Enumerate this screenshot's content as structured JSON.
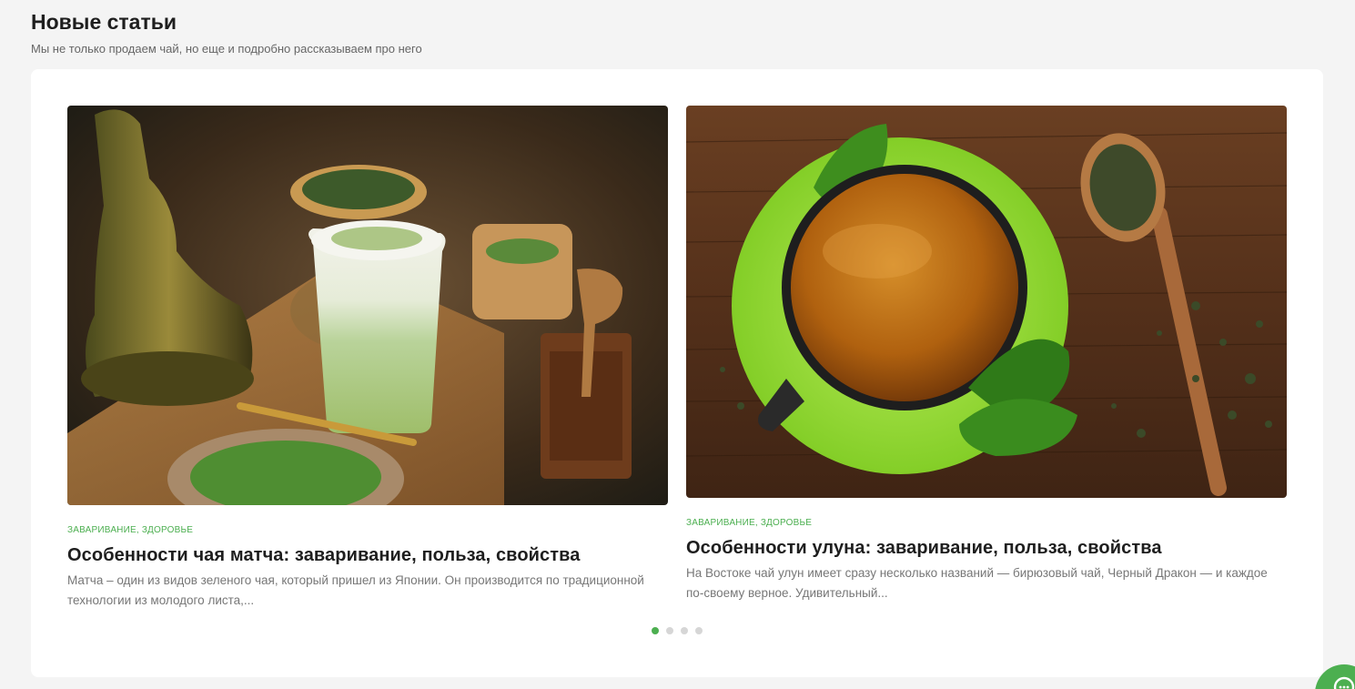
{
  "section": {
    "title": "Новые статьи",
    "subtitle": "Мы не только продаем чай, но еще и подробно рассказываем про него"
  },
  "articles": [
    {
      "tags": "ЗАВАРИВАНИЕ, ЗДОРОВЬЕ",
      "title": "Особенности чая матча: заваривание, польза, свойства",
      "excerpt": "Матча – один из видов зеленого чая, который пришел из Японии. Он производится по традиционной технологии из молодого листа,..."
    },
    {
      "tags": "ЗАВАРИВАНИЕ, ЗДОРОВЬЕ",
      "title": "Особенности улуна: заваривание, польза, свойства",
      "excerpt": "На Востоке чай улун имеет сразу несколько названий — бирюзовый чай, Черный Дракон — и каждое по-своему верное. Удивительный..."
    }
  ],
  "carousel": {
    "total_slides": 4,
    "active_slide": 1
  },
  "colors": {
    "accent": "#4caf50",
    "background": "#f4f4f4",
    "card": "#ffffff"
  },
  "icons": {
    "chat": "chat-icon"
  }
}
